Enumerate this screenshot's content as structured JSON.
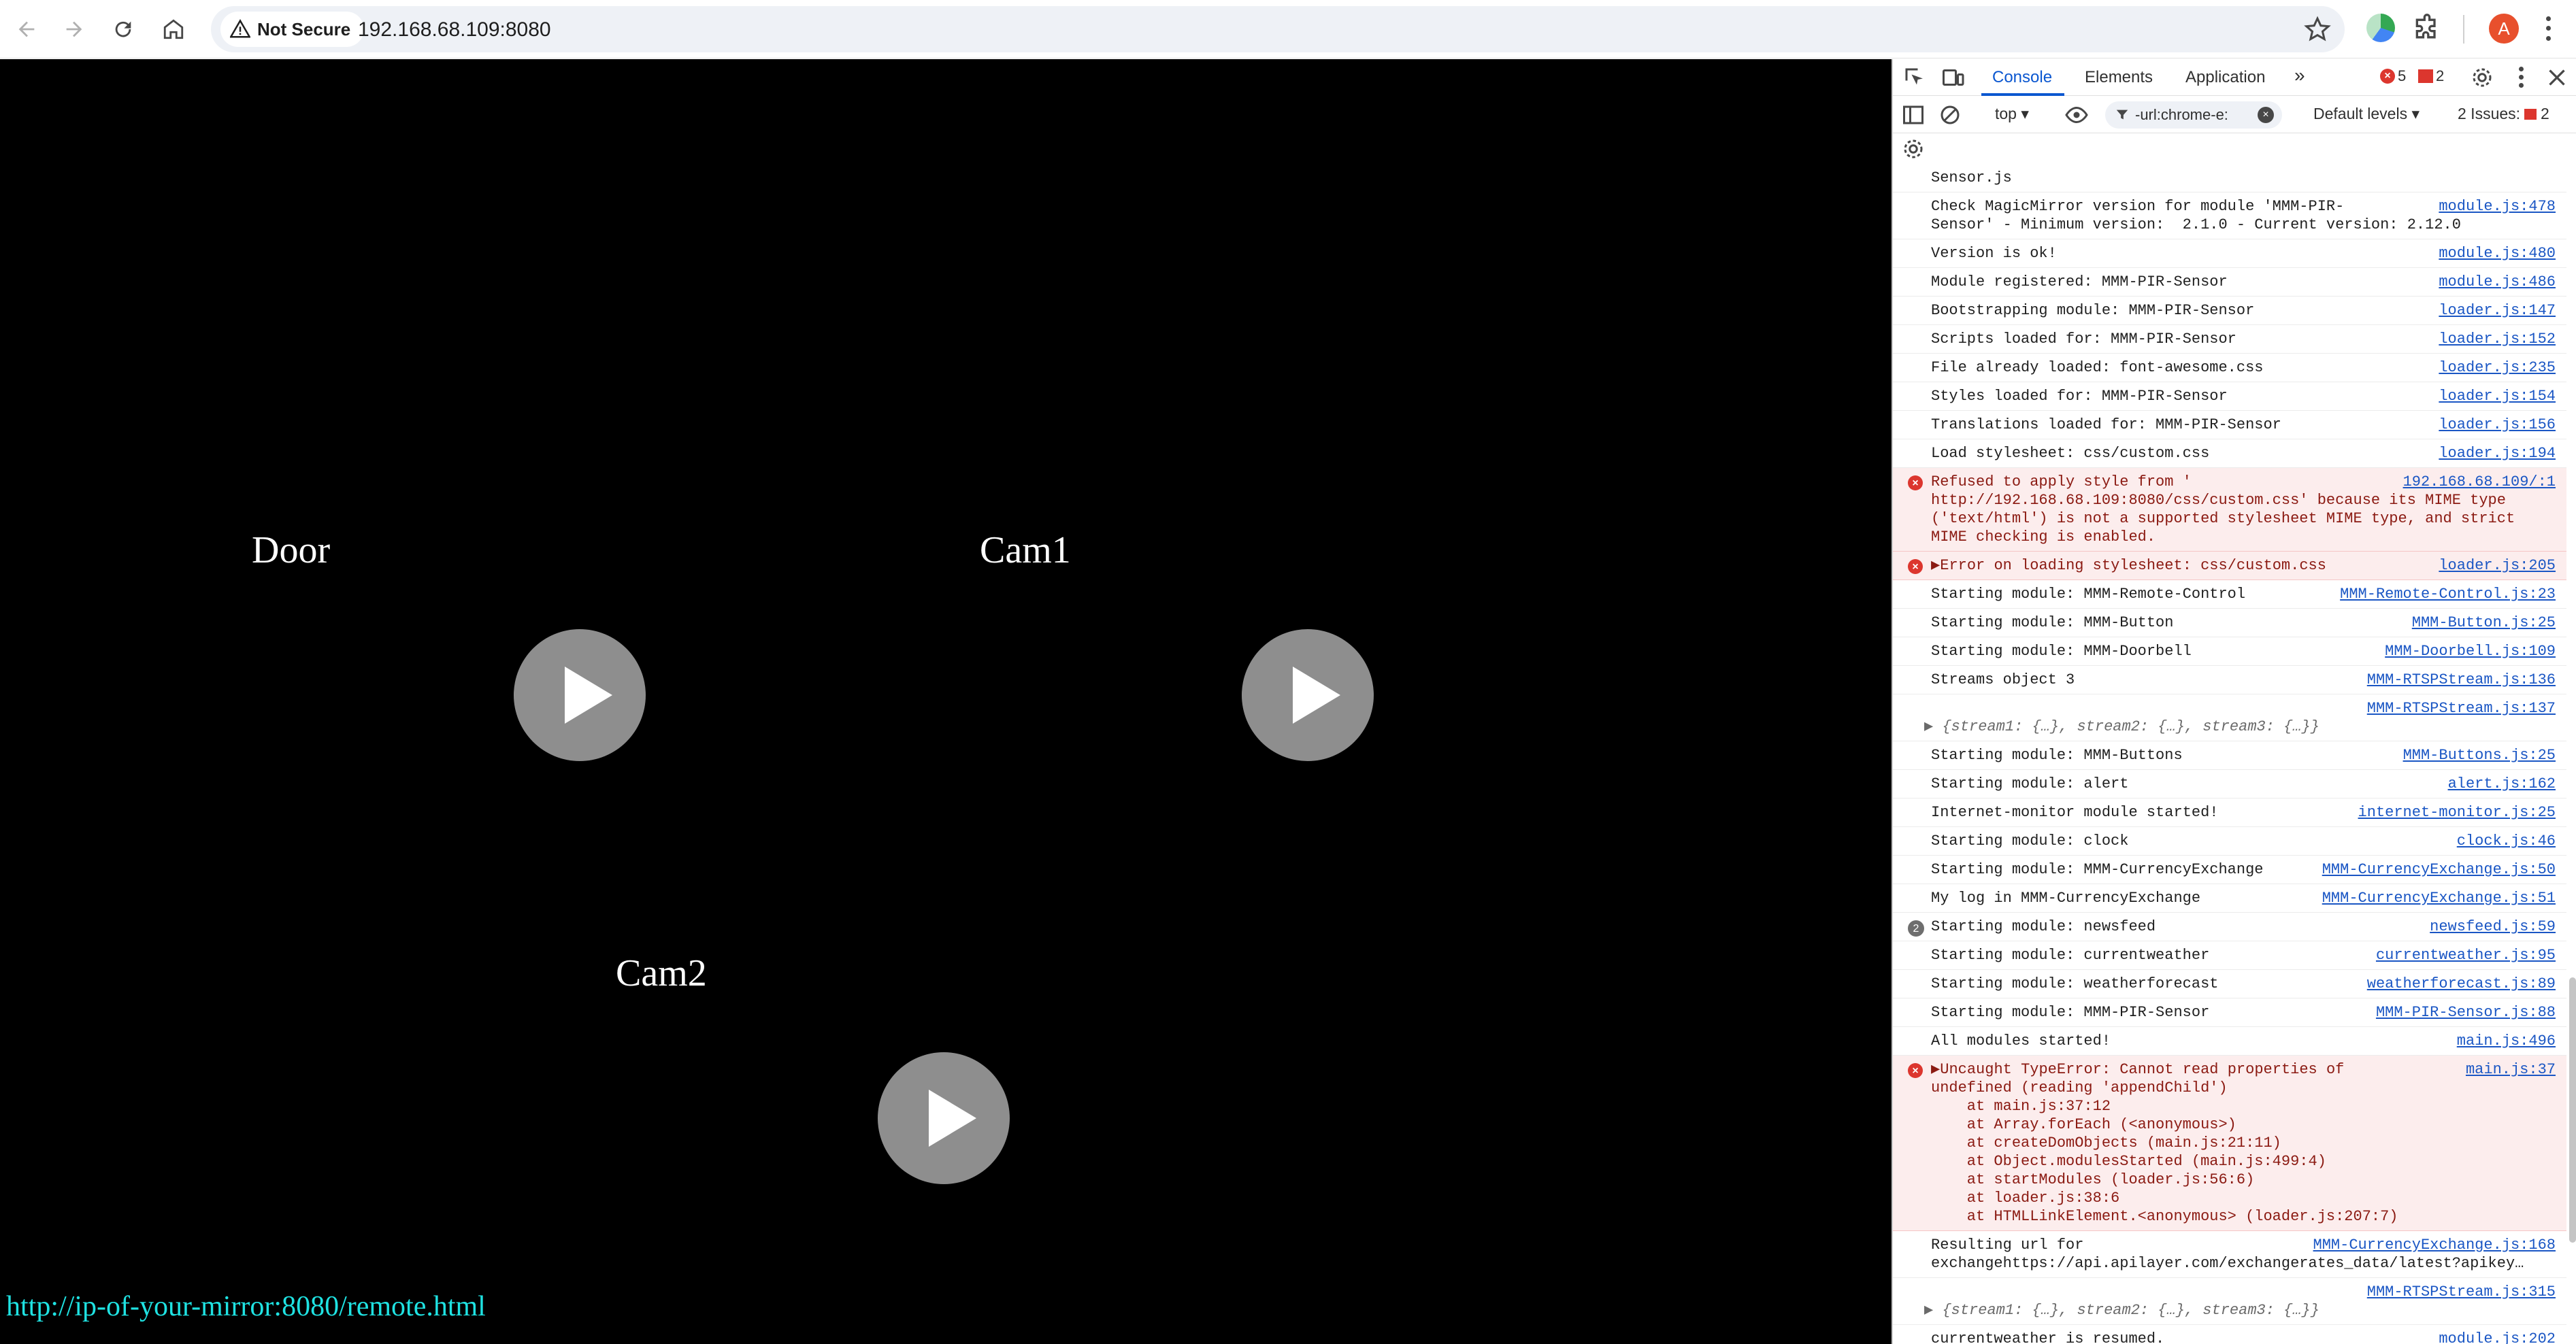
{
  "browser": {
    "security_label": "Not Secure",
    "url": "192.168.68.109:8080",
    "avatar_initial": "A"
  },
  "page": {
    "cams": [
      {
        "label": "Door"
      },
      {
        "label": "Cam1"
      },
      {
        "label": "Cam2"
      }
    ],
    "remote_link": "http://ip-of-your-mirror:8080/remote.html"
  },
  "devtools": {
    "tabs": [
      "Console",
      "Elements",
      "Application"
    ],
    "error_count": "5",
    "issue_count": "2",
    "context": "top",
    "filter": "-url:chrome-e:",
    "levels": "Default levels",
    "issues_label": "2 Issues:",
    "issues_badge": "2"
  },
  "console": {
    "messages": [
      {
        "text": "Sensor.js",
        "src": ""
      },
      {
        "text": "Check MagicMirror version for module 'MMM-PIR-\nSensor' - Minimum version:  2.1.0 - Current version: 2.12.0",
        "src": "module.js:478"
      },
      {
        "text": "Version is ok!",
        "src": "module.js:480"
      },
      {
        "text": "Module registered: MMM-PIR-Sensor",
        "src": "module.js:486"
      },
      {
        "text": "Bootstrapping module: MMM-PIR-Sensor",
        "src": "loader.js:147"
      },
      {
        "text": "Scripts loaded for: MMM-PIR-Sensor",
        "src": "loader.js:152"
      },
      {
        "text": "File already loaded: font-awesome.css",
        "src": "loader.js:235"
      },
      {
        "text": "Styles loaded for: MMM-PIR-Sensor",
        "src": "loader.js:154"
      },
      {
        "text": "Translations loaded for: MMM-PIR-Sensor",
        "src": "loader.js:156"
      },
      {
        "text": "Load stylesheet: css/custom.css",
        "src": "loader.js:194"
      },
      {
        "text": "Refused to apply style from '\nhttp://192.168.68.109:8080/css/custom.css' because its MIME type\n('text/html') is not a supported stylesheet MIME type, and strict\nMIME checking is enabled.",
        "src": "192.168.68.109/:1",
        "level": "error"
      },
      {
        "text": "▶Error on loading stylesheet: css/custom.css",
        "src": "loader.js:205",
        "level": "error"
      },
      {
        "text": "Starting module: MMM-Remote-Control",
        "src": "MMM-Remote-Control.js:23"
      },
      {
        "text": "Starting module: MMM-Button",
        "src": "MMM-Button.js:25"
      },
      {
        "text": "Starting module: MMM-Doorbell",
        "src": "MMM-Doorbell.js:109"
      },
      {
        "text": "Streams object 3",
        "src": "MMM-RTSPStream.js:136"
      },
      {
        "text": "",
        "src": "MMM-RTSPStream.js:137",
        "obj": "▶ {stream1: {…}, stream2: {…}, stream3: {…}}"
      },
      {
        "text": "Starting module: MMM-Buttons",
        "src": "MMM-Buttons.js:25"
      },
      {
        "text": "Starting module: alert",
        "src": "alert.js:162"
      },
      {
        "text": "Internet-monitor module started!",
        "src": "internet-monitor.js:25"
      },
      {
        "text": "Starting module: clock",
        "src": "clock.js:46"
      },
      {
        "text": "Starting module: MMM-CurrencyExchange",
        "src": "MMM-CurrencyExchange.js:50"
      },
      {
        "text": "My log in MMM-CurrencyExchange",
        "src": "MMM-CurrencyExchange.js:51"
      },
      {
        "text": "Starting module: newsfeed",
        "src": "newsfeed.js:59",
        "count": "2"
      },
      {
        "text": "Starting module: currentweather",
        "src": "currentweather.js:95"
      },
      {
        "text": "Starting module: weatherforecast",
        "src": "weatherforecast.js:89"
      },
      {
        "text": "Starting module: MMM-PIR-Sensor",
        "src": "MMM-PIR-Sensor.js:88"
      },
      {
        "text": "All modules started!",
        "src": "main.js:496"
      },
      {
        "text": "▶Uncaught TypeError: Cannot read properties of\nundefined (reading 'appendChild')\n    at main.js:37:12\n    at Array.forEach (<anonymous>)\n    at createDomObjects (main.js:21:11)\n    at Object.modulesStarted (main.js:499:4)\n    at startModules (loader.js:56:6)\n    at loader.js:38:6\n    at HTMLLinkElement.<anonymous> (loader.js:207:7)",
        "src": "main.js:37",
        "level": "error"
      },
      {
        "text": "Resulting url for\nexchangehttps://api.apilayer.com/exchangerates_data/latest?apikey…",
        "src": "MMM-CurrencyExchange.js:168"
      },
      {
        "text": "",
        "src": "MMM-RTSPStream.js:315",
        "obj": "▶ {stream1: {…}, stream2: {…}, stream3: {…}}"
      },
      {
        "text": "currentweather is resumed.",
        "src": "module.js:202"
      }
    ]
  },
  "colors": {
    "link_cyan": "#1fe2e2",
    "error_red": "#dc362e",
    "devtools_blue": "#0b57d0"
  },
  "icons": [
    "back-arrow-icon",
    "forward-arrow-icon",
    "reload-icon",
    "home-icon",
    "warning-icon",
    "star-icon",
    "extension-icon",
    "puzzle-icon",
    "kebab-menu-icon",
    "play-icon",
    "inspect-icon",
    "device-icon",
    "gear-icon",
    "close-icon",
    "clear-icon",
    "eye-icon",
    "filter-icon"
  ]
}
